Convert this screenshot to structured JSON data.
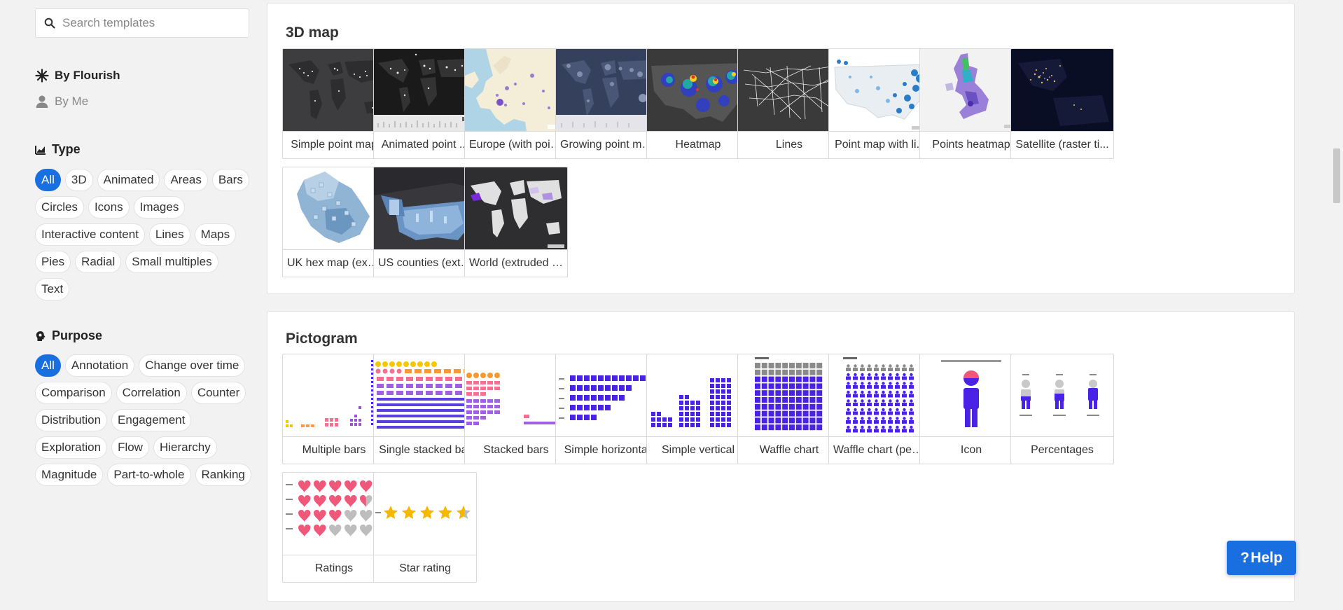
{
  "search": {
    "placeholder": "Search templates"
  },
  "ownership": {
    "by_flourish": "By Flourish",
    "by_me": "By Me"
  },
  "filters": {
    "type": {
      "title": "Type",
      "items": [
        "All",
        "3D",
        "Animated",
        "Areas",
        "Bars",
        "Circles",
        "Icons",
        "Images",
        "Interactive content",
        "Lines",
        "Maps",
        "Pies",
        "Radial",
        "Small multiples",
        "Text"
      ],
      "active": "All"
    },
    "purpose": {
      "title": "Purpose",
      "items": [
        "All",
        "Annotation",
        "Change over time",
        "Comparison",
        "Correlation",
        "Counter",
        "Distribution",
        "Engagement",
        "Exploration",
        "Flow",
        "Hierarchy",
        "Magnitude",
        "Part-to-whole",
        "Ranking"
      ],
      "active": "All"
    }
  },
  "sections": [
    {
      "title": "3D map",
      "cards": [
        {
          "label": "Simple point map",
          "icon": "dark-world-points-thumb"
        },
        {
          "label": "Animated point ...",
          "icon": "dark-world-timeline-thumb"
        },
        {
          "label": "Europe (with poin...",
          "icon": "europe-map-thumb"
        },
        {
          "label": "Growing point map",
          "icon": "navy-world-bubbles-thumb"
        },
        {
          "label": "Heatmap",
          "icon": "us-heatmap-thumb"
        },
        {
          "label": "Lines",
          "icon": "us-lines-thumb"
        },
        {
          "label": "Point map with li...",
          "icon": "us-point-legend-thumb"
        },
        {
          "label": "Points heatmap",
          "icon": "uk-points-heatmap-thumb"
        },
        {
          "label": "Satellite (raster ti...",
          "icon": "satellite-night-thumb"
        },
        {
          "label": "UK hex map (extr...",
          "icon": "uk-hex-extruded-thumb"
        },
        {
          "label": "US counties (extr...",
          "icon": "us-counties-extruded-thumb"
        },
        {
          "label": "World (extruded r...",
          "icon": "world-extruded-thumb"
        }
      ]
    },
    {
      "title": "Pictogram",
      "cards": [
        {
          "label": "Multiple bars",
          "icon": "multiple-bars-thumb"
        },
        {
          "label": "Single stacked bar",
          "icon": "single-stacked-bar-thumb"
        },
        {
          "label": "Stacked bars",
          "icon": "stacked-bars-thumb"
        },
        {
          "label": "Simple horizontal",
          "icon": "simple-horizontal-thumb"
        },
        {
          "label": "Simple vertical",
          "icon": "simple-vertical-thumb"
        },
        {
          "label": "Waffle chart",
          "icon": "waffle-chart-thumb"
        },
        {
          "label": "Waffle chart (peo...",
          "icon": "waffle-people-thumb"
        },
        {
          "label": "Icon",
          "icon": "person-icon-thumb"
        },
        {
          "label": "Percentages",
          "icon": "percentages-thumb"
        },
        {
          "label": "Ratings",
          "icon": "heart-ratings-thumb"
        },
        {
          "label": "Star rating",
          "icon": "star-rating-thumb"
        }
      ]
    }
  ],
  "help": {
    "label": "Help",
    "glyph": "?"
  },
  "colors": {
    "accent": "#1a6fe0",
    "pictogram": "#4a22e6",
    "heart": "#f0587a",
    "star": "#f5b800"
  }
}
